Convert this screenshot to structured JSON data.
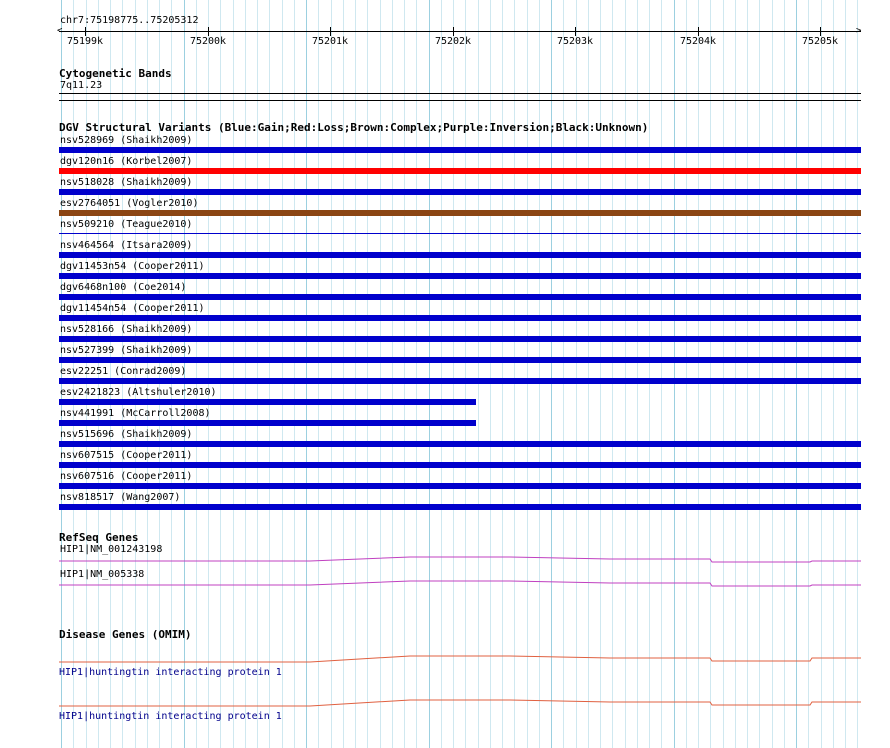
{
  "ruler": {
    "position": "chr7:75198775..75205312",
    "ticks": [
      "75199k",
      "75200k",
      "75201k",
      "75202k",
      "75203k",
      "75204k",
      "75205k"
    ]
  },
  "cytogenetic": {
    "title": "Cytogenetic Bands",
    "band": "7q11.23"
  },
  "dgv": {
    "title": "DGV Structural Variants (Blue:Gain;Red:Loss;Brown:Complex;Purple:Inversion;Black:Unknown)",
    "colors": {
      "gain": "#0000cc",
      "loss": "#ff0000",
      "complex": "#8b4513"
    },
    "variants": [
      {
        "label": "nsv528969 (Shaikh2009)",
        "type": "gain",
        "coverage": 1.0
      },
      {
        "label": "dgv120n16 (Korbel2007)",
        "type": "loss",
        "coverage": 1.0
      },
      {
        "label": "nsv518028 (Shaikh2009)",
        "type": "gain",
        "coverage": 1.0
      },
      {
        "label": "esv2764051 (Vogler2010)",
        "type": "complex",
        "coverage": 1.0
      },
      {
        "label": "nsv509210 (Teague2010)",
        "type": "gain",
        "coverage": 1.0,
        "thin": true
      },
      {
        "label": "nsv464564 (Itsara2009)",
        "type": "gain",
        "coverage": 1.0
      },
      {
        "label": "dgv11453n54 (Cooper2011)",
        "type": "gain",
        "coverage": 1.0
      },
      {
        "label": "dgv6468n100 (Coe2014)",
        "type": "gain",
        "coverage": 1.0
      },
      {
        "label": "dgv11454n54 (Cooper2011)",
        "type": "gain",
        "coverage": 1.0
      },
      {
        "label": "nsv528166 (Shaikh2009)",
        "type": "gain",
        "coverage": 1.0
      },
      {
        "label": "nsv527399 (Shaikh2009)",
        "type": "gain",
        "coverage": 1.0
      },
      {
        "label": "esv22251 (Conrad2009)",
        "type": "gain",
        "coverage": 1.0
      },
      {
        "label": "esv2421823 (Altshuler2010)",
        "type": "gain",
        "coverage": 0.52
      },
      {
        "label": "nsv441991 (McCarroll2008)",
        "type": "gain",
        "coverage": 0.52
      },
      {
        "label": "nsv515696 (Shaikh2009)",
        "type": "gain",
        "coverage": 1.0
      },
      {
        "label": "nsv607515 (Cooper2011)",
        "type": "gain",
        "coverage": 1.0
      },
      {
        "label": "nsv607516 (Cooper2011)",
        "type": "gain",
        "coverage": 1.0
      },
      {
        "label": "nsv818517 (Wang2007)",
        "type": "gain",
        "coverage": 1.0
      }
    ]
  },
  "refseq": {
    "title": "RefSeq Genes",
    "color": "#c040c0",
    "genes": [
      {
        "label": "HIP1|NM_001243198"
      },
      {
        "label": "HIP1|NM_005338"
      }
    ]
  },
  "omim": {
    "title": "Disease Genes (OMIM)",
    "color": "#e06040",
    "genes": [
      {
        "label": "HIP1|huntingtin interacting protein 1"
      },
      {
        "label": "HIP1|huntingtin interacting protein 1"
      }
    ]
  }
}
